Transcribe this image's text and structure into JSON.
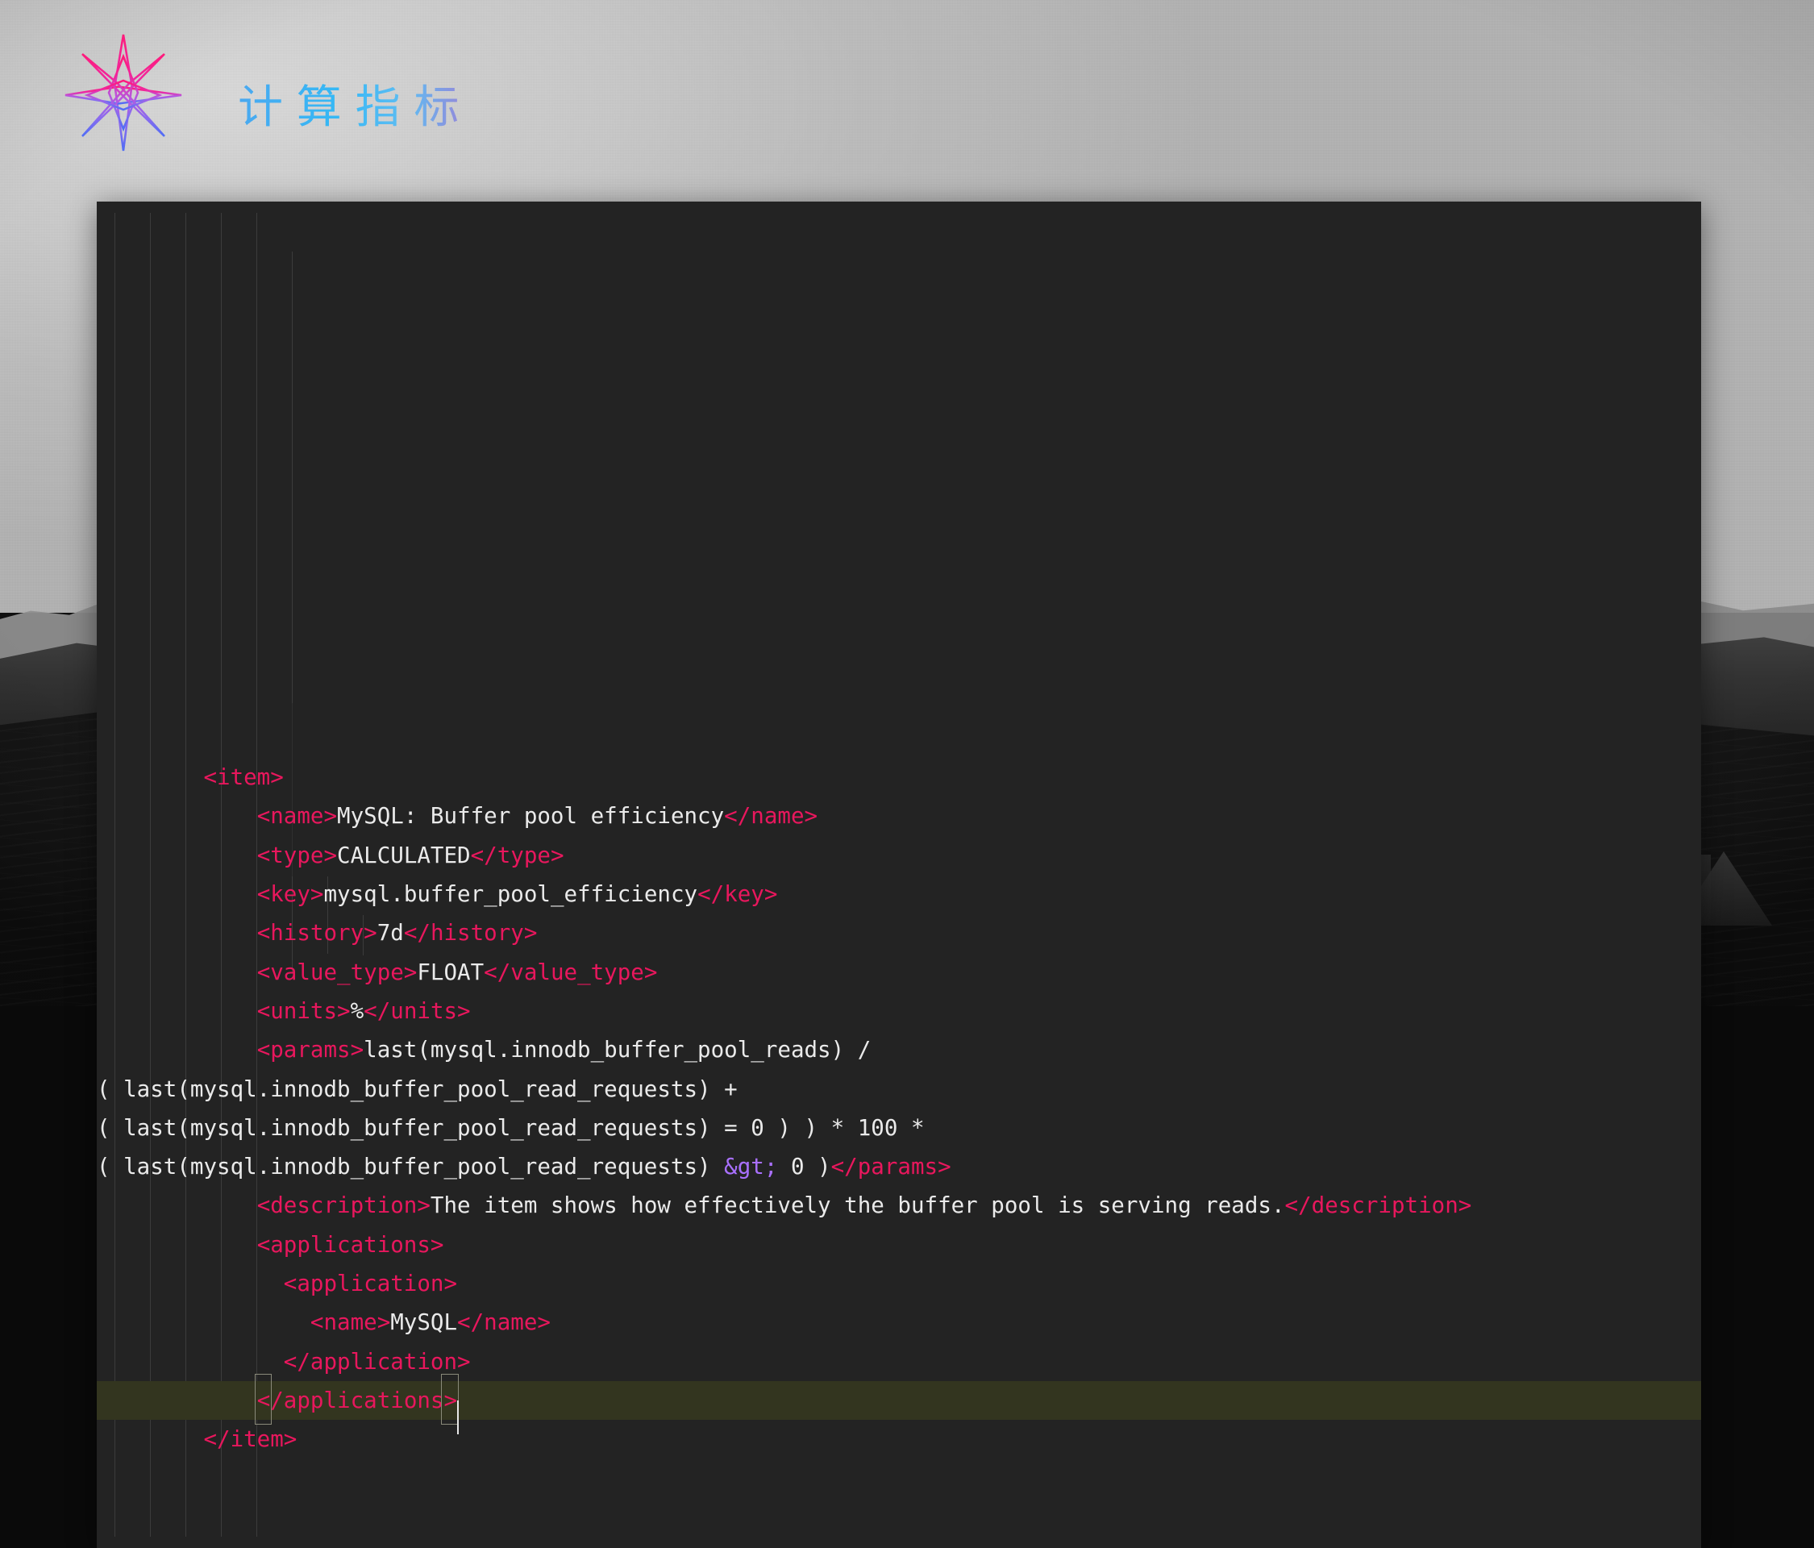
{
  "header": {
    "title": "计算指标",
    "logo_icon": "eight-point-star-icon",
    "title_gradient_from": "#4aa8f0",
    "title_gradient_to": "#9e7fd6",
    "logo_gradient_from": "#ff1a8c",
    "logo_gradient_to": "#5b6bf0"
  },
  "editor": {
    "background": "#232323",
    "tag_color": "#e8175d",
    "text_color": "#eaeaea",
    "entity_color": "#a970ff",
    "active_line_color": "#33351f",
    "indent_guide_color": "#3c3c3c",
    "language": "XML",
    "active_line_index": 16,
    "cursor_line_text": "</application>",
    "lines": [
      {
        "indent": "        ",
        "segments": [
          {
            "t": "tag",
            "v": "<item>"
          }
        ]
      },
      {
        "indent": "            ",
        "segments": [
          {
            "t": "tag",
            "v": "<name>"
          },
          {
            "t": "txt",
            "v": "MySQL: Buffer pool efficiency"
          },
          {
            "t": "tag",
            "v": "</name>"
          }
        ]
      },
      {
        "indent": "            ",
        "segments": [
          {
            "t": "tag",
            "v": "<type>"
          },
          {
            "t": "txt",
            "v": "CALCULATED"
          },
          {
            "t": "tag",
            "v": "</type>"
          }
        ]
      },
      {
        "indent": "            ",
        "segments": [
          {
            "t": "tag",
            "v": "<key>"
          },
          {
            "t": "txt",
            "v": "mysql.buffer_pool_efficiency"
          },
          {
            "t": "tag",
            "v": "</key>"
          }
        ]
      },
      {
        "indent": "            ",
        "segments": [
          {
            "t": "tag",
            "v": "<history>"
          },
          {
            "t": "txt",
            "v": "7d"
          },
          {
            "t": "tag",
            "v": "</history>"
          }
        ]
      },
      {
        "indent": "            ",
        "segments": [
          {
            "t": "tag",
            "v": "<value_type>"
          },
          {
            "t": "txt",
            "v": "FLOAT"
          },
          {
            "t": "tag",
            "v": "</value_type>"
          }
        ]
      },
      {
        "indent": "            ",
        "segments": [
          {
            "t": "tag",
            "v": "<units>"
          },
          {
            "t": "txt",
            "v": "%"
          },
          {
            "t": "tag",
            "v": "</units>"
          }
        ]
      },
      {
        "indent": "            ",
        "segments": [
          {
            "t": "tag",
            "v": "<params>"
          },
          {
            "t": "txt",
            "v": "last(mysql.innodb_buffer_pool_reads) /"
          }
        ]
      },
      {
        "indent": "",
        "segments": [
          {
            "t": "txt",
            "v": "( last(mysql.innodb_buffer_pool_read_requests) +"
          }
        ]
      },
      {
        "indent": "",
        "segments": [
          {
            "t": "txt",
            "v": "( last(mysql.innodb_buffer_pool_read_requests) = 0 ) ) * 100 *"
          }
        ]
      },
      {
        "indent": "",
        "segments": [
          {
            "t": "txt",
            "v": "( last(mysql.innodb_buffer_pool_read_requests) "
          },
          {
            "t": "ent",
            "v": "&gt;"
          },
          {
            "t": "txt",
            "v": " 0 )"
          },
          {
            "t": "tag",
            "v": "</params>"
          }
        ]
      },
      {
        "indent": "            ",
        "segments": [
          {
            "t": "tag",
            "v": "<description>"
          },
          {
            "t": "txt",
            "v": "The item shows how effectively the buffer pool is serving reads."
          },
          {
            "t": "tag",
            "v": "</description>"
          }
        ]
      },
      {
        "indent": "            ",
        "segments": [
          {
            "t": "tag",
            "v": "<applications>"
          }
        ]
      },
      {
        "indent": "              ",
        "segments": [
          {
            "t": "tag",
            "v": "<application>"
          }
        ]
      },
      {
        "indent": "                ",
        "segments": [
          {
            "t": "tag",
            "v": "<name>"
          },
          {
            "t": "txt",
            "v": "MySQL"
          },
          {
            "t": "tag",
            "v": "</name>"
          }
        ]
      },
      {
        "indent": "              ",
        "segments": [
          {
            "t": "tag",
            "v": "</application>"
          }
        ]
      },
      {
        "indent": "            ",
        "segments": [
          {
            "t": "tag",
            "v": "</applications>"
          }
        ]
      },
      {
        "indent": "        ",
        "segments": [
          {
            "t": "tag",
            "v": "</item>"
          }
        ]
      }
    ]
  }
}
